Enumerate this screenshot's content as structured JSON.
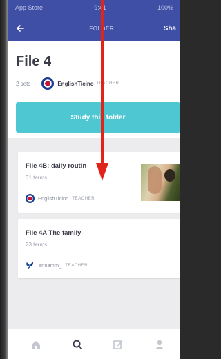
{
  "status_bar": {
    "left": "App Store",
    "center": "9:41",
    "right": "100%"
  },
  "app_bar": {
    "title": "FOLDER",
    "share_label": "Sha"
  },
  "folder": {
    "title": "File 4",
    "sets_count": "2 sets",
    "creator_name": "EnglishTicino",
    "creator_role": "TEACHER",
    "study_button_label": "Study this folder"
  },
  "sets": [
    {
      "title": "File 4B: daily routin",
      "terms": "31 terms",
      "author": "EnglishTicino",
      "role": "TEACHER",
      "has_thumbnail": true
    },
    {
      "title": "File 4A The family",
      "terms": "23 terms",
      "author": "annamm_",
      "role": "TEACHER",
      "has_thumbnail": false
    }
  ],
  "bottom_nav": [
    {
      "icon": "home-icon"
    },
    {
      "icon": "search-icon"
    },
    {
      "icon": "create-icon"
    },
    {
      "icon": "profile-icon"
    }
  ],
  "colors": {
    "app_bar": "#3f4fa6",
    "study_button": "#4fc7d3",
    "annotation_arrow": "#e2231a"
  }
}
